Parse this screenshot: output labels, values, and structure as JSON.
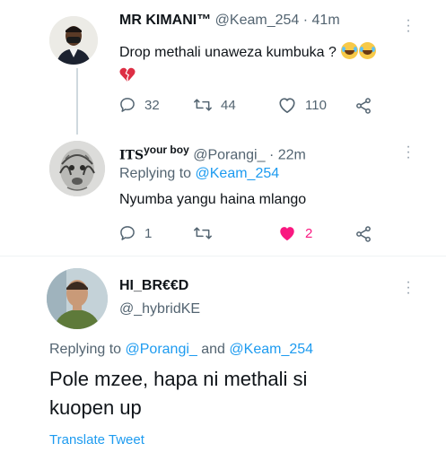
{
  "tweets": [
    {
      "display_name": "MR KIMANI™",
      "handle": "@Keam_254 · 41m",
      "text": "Drop methali unaweza kumbuka ?",
      "emoji": [
        "face-with-tears-of-joy",
        "face-with-tears-of-joy",
        "broken-heart"
      ],
      "replies": "32",
      "retweets": "44",
      "likes": "110"
    },
    {
      "display_name_prefix": "ITS",
      "display_name_suffix": "your boy",
      "handle": "@Porangi_ · 22m",
      "replying_label": "Replying to",
      "replying_to": "@Keam_254",
      "text": "Nyumba yangu haina mlango",
      "replies": "1",
      "likes": "2",
      "like_color": "#f91880"
    },
    {
      "display_name": "HI_BR€€D",
      "handle": "@_hybridKE",
      "replying_label": "Replying to",
      "replying_to_1": "@Porangi_",
      "replying_and": "and",
      "replying_to_2": "@Keam_254",
      "text_line1": "Pole mzee, hapa ni methali si",
      "text_line2": "kuopen up",
      "translate": "Translate Tweet"
    }
  ],
  "colors": {
    "link": "#1d9bf0",
    "secondary": "#536471",
    "like": "#f91880"
  }
}
